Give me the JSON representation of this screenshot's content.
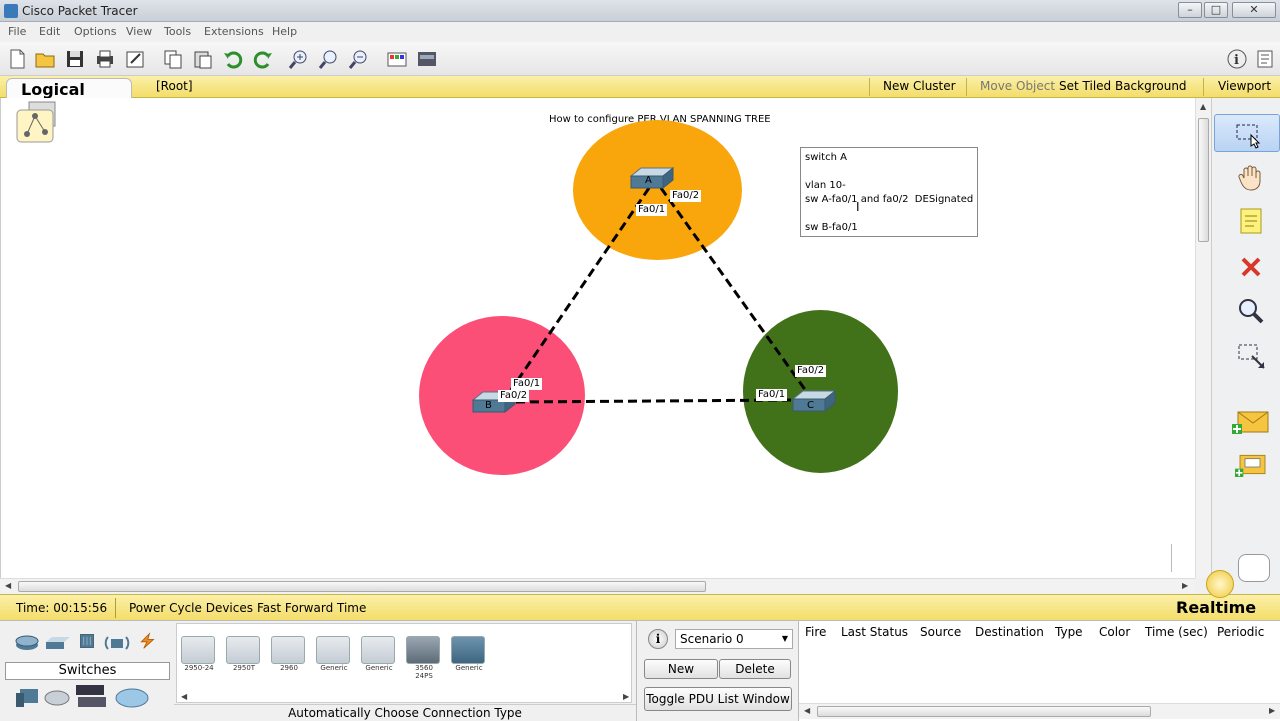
{
  "window": {
    "title": "Cisco Packet Tracer"
  },
  "menu": [
    "File",
    "Edit",
    "Options",
    "View",
    "Tools",
    "Extensions",
    "Help"
  ],
  "workspace_bar": {
    "tab_label": "Logical",
    "root_label": "[Root]",
    "new_cluster": "New Cluster",
    "move_object": "Move Object",
    "set_tiled_background": "Set Tiled Background",
    "viewport": "Viewport"
  },
  "canvas": {
    "title": "How to configure PER VLAN SPANNING TREE",
    "note_lines": [
      "switch A",
      "",
      "vlan 10-",
      "sw A-fa0/1 and fa0/2  DESignated",
      "",
      "sw B-fa0/1"
    ],
    "zones": [
      {
        "name": "zone-a",
        "color": "#f8a60b"
      },
      {
        "name": "zone-b",
        "color": "#fc4f78"
      },
      {
        "name": "zone-c",
        "color": "#417118"
      }
    ],
    "switches": [
      {
        "id": "sw-a",
        "label": "A"
      },
      {
        "id": "sw-b",
        "label": "B"
      },
      {
        "id": "sw-c",
        "label": "C"
      }
    ],
    "port_labels": {
      "a_fa02": "Fa0/2",
      "a_fa01": "Fa0/1",
      "b_fa01": "Fa0/1",
      "b_fa02": "Fa0/2",
      "c_fa02": "Fa0/2",
      "c_fa01": "Fa0/1"
    }
  },
  "status": {
    "time": "Time: 00:15:56",
    "power_cycle": "Power Cycle Devices",
    "fast_forward": "Fast Forward Time",
    "mode": "Realtime"
  },
  "device_panel": {
    "category_label": "Switches",
    "devices": [
      {
        "label": "2950-24"
      },
      {
        "label": "2950T"
      },
      {
        "label": "2960"
      },
      {
        "label": "Generic"
      },
      {
        "label": "Generic"
      },
      {
        "label": "3560 24PS"
      },
      {
        "label": "Generic"
      }
    ],
    "connection_hint": "Automatically Choose Connection Type"
  },
  "scenario": {
    "selected": "Scenario 0",
    "new": "New",
    "delete": "Delete",
    "toggle": "Toggle PDU List Window"
  },
  "pdu_table": {
    "columns": [
      "Fire",
      "Last Status",
      "Source",
      "Destination",
      "Type",
      "Color",
      "Time (sec)",
      "Periodic"
    ]
  },
  "toolbar_icons": [
    "new-file-icon",
    "open-folder-icon",
    "save-icon",
    "print-icon",
    "activity-wizard-icon",
    "copy-icon",
    "paste-icon",
    "undo-icon",
    "redo-icon",
    "zoom-in-icon",
    "zoom-reset-icon",
    "zoom-out-icon",
    "drawing-palette-icon",
    "custom-device-icon",
    "help-icon"
  ]
}
